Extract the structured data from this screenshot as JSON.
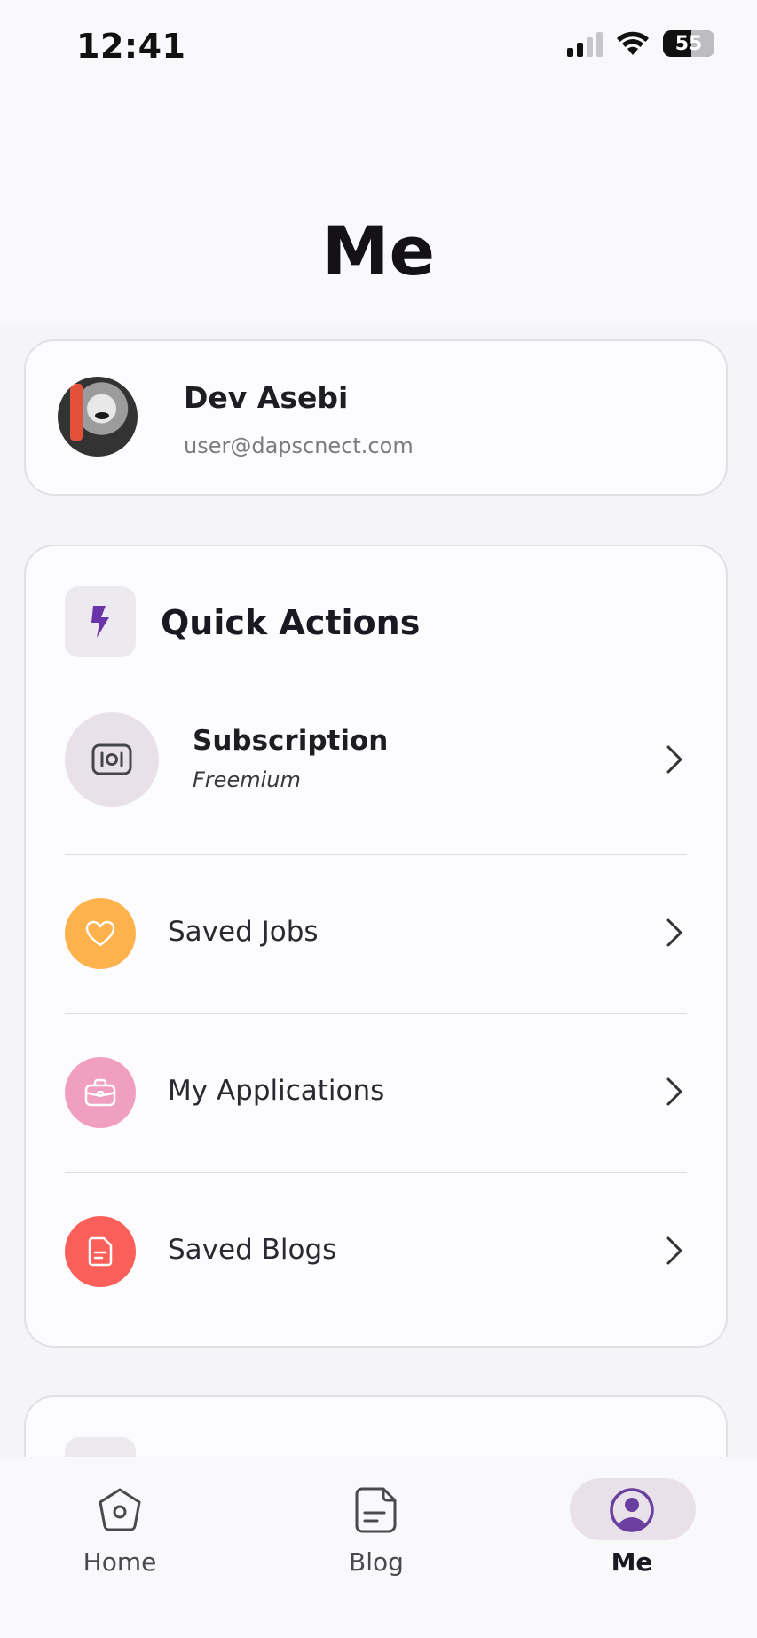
{
  "status_bar": {
    "time": "12:41",
    "battery": "55"
  },
  "header": {
    "title": "Me"
  },
  "profile": {
    "name": "Dev Asebi",
    "email": "user@dapscnect.com"
  },
  "quick_actions": {
    "title": "Quick Actions",
    "subscription": {
      "label": "Subscription",
      "plan": "Freemium"
    },
    "items": [
      {
        "label": "Saved Jobs",
        "icon": "heart-icon",
        "color": "#feb24b"
      },
      {
        "label": "My Applications",
        "icon": "briefcase-icon",
        "color": "#f19fc0"
      },
      {
        "label": "Saved Blogs",
        "icon": "document-icon",
        "color": "#fa6059"
      }
    ]
  },
  "bottom_nav": {
    "items": [
      {
        "label": "Home",
        "icon": "home-icon"
      },
      {
        "label": "Blog",
        "icon": "blog-icon"
      },
      {
        "label": "Me",
        "icon": "profile-icon",
        "active": true
      }
    ]
  },
  "colors": {
    "accent": "#6b3fa0",
    "active_pill": "#e8e1ea"
  }
}
